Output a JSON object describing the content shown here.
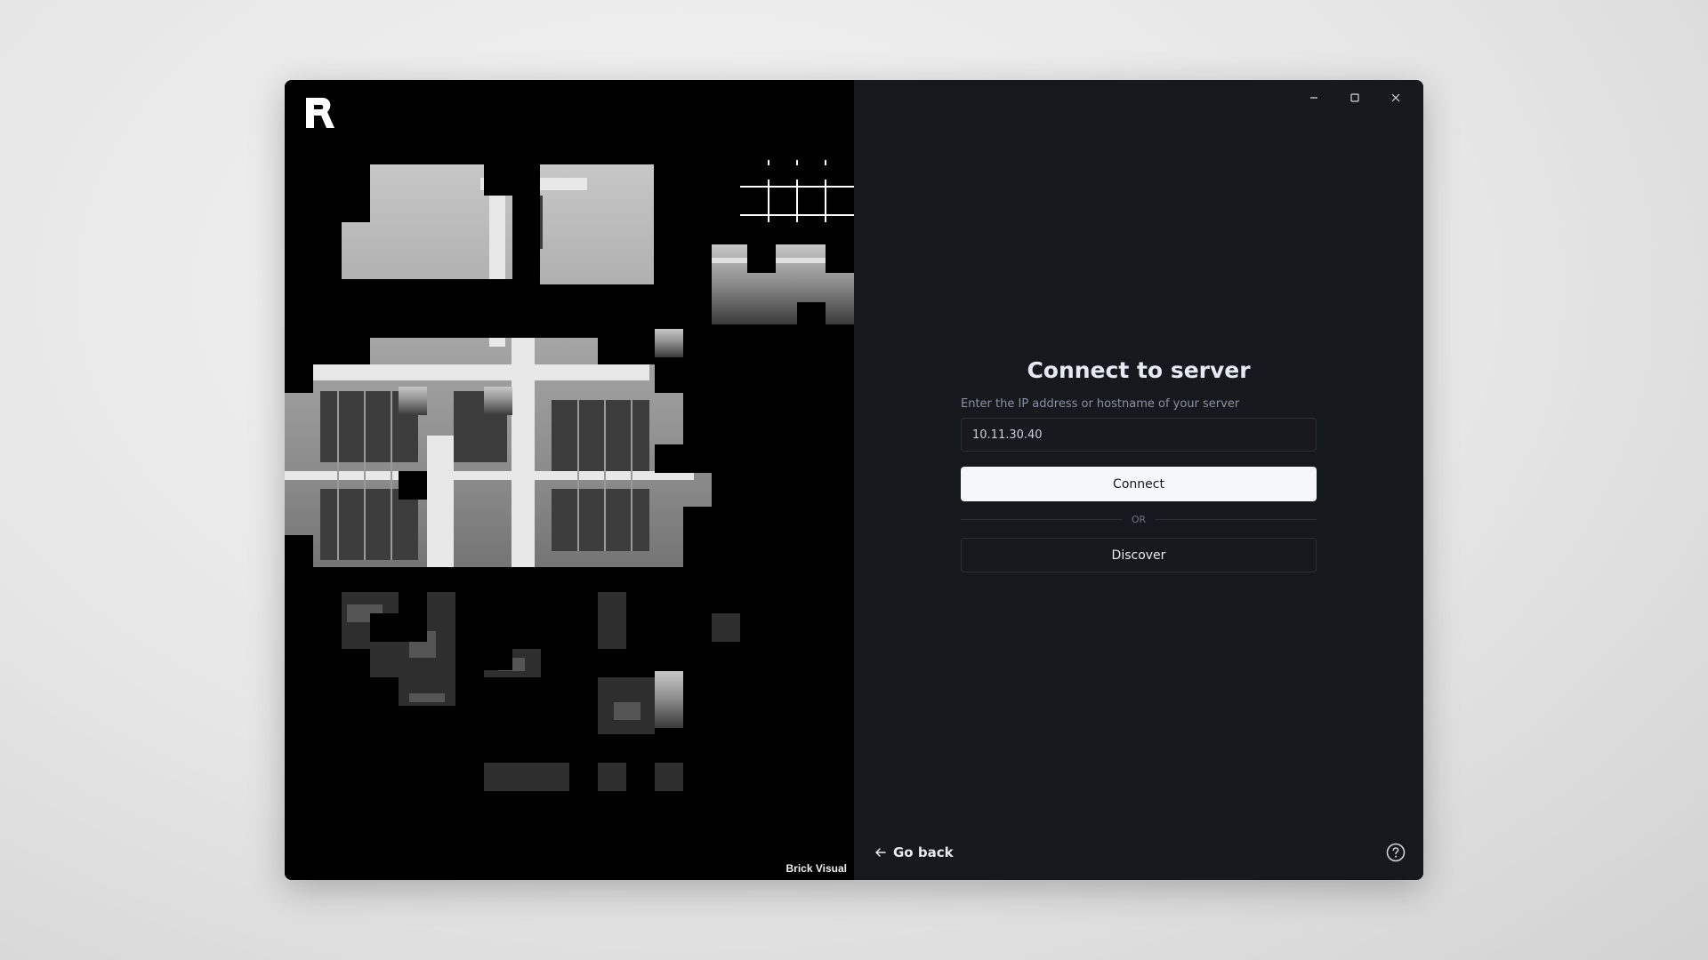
{
  "window": {
    "controls": {
      "minimize_icon": "minimize-icon",
      "maximize_icon": "maximize-icon",
      "close_icon": "close-icon"
    }
  },
  "left": {
    "logo_icon": "r-logo-icon",
    "image_subject": "architecture-photo",
    "credit": "Brick Visual"
  },
  "connect": {
    "title": "Connect to server",
    "prompt": "Enter the IP address or hostname of your server",
    "input_value": "10.11.30.40",
    "connect_label": "Connect",
    "or_label": "OR",
    "discover_label": "Discover"
  },
  "footer": {
    "go_back_label": "Go back",
    "help_icon": "help-icon"
  },
  "colors": {
    "window_bg": "#15181d",
    "primary_button": "#f6f7f9",
    "title_text": "#e4e9f3",
    "muted_text": "#8b92a0",
    "border": "#2a2e36"
  }
}
